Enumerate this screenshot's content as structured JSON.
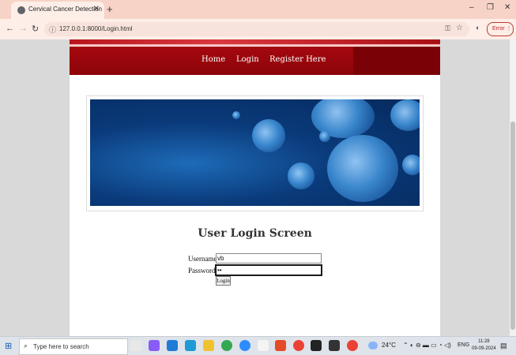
{
  "browser": {
    "tab_title": "Cervical Cancer Detection",
    "url": "127.0.0.1:8000/Login.html",
    "error_label": "Error"
  },
  "nav": {
    "home": "Home",
    "login": "Login",
    "register": "Register Here"
  },
  "form": {
    "heading": "User Login Screen",
    "username_label": "Username",
    "username_value": "vb",
    "password_label": "Password",
    "password_value": "••",
    "login_button": "Login"
  },
  "taskbar": {
    "search_placeholder": "Type here to search",
    "temperature": "24°C",
    "language": "ENG",
    "time": "11:28",
    "date": "09-09-2024"
  },
  "colors": {
    "nav_red": "#9a050b",
    "tab_bar": "#f6d3c6"
  }
}
